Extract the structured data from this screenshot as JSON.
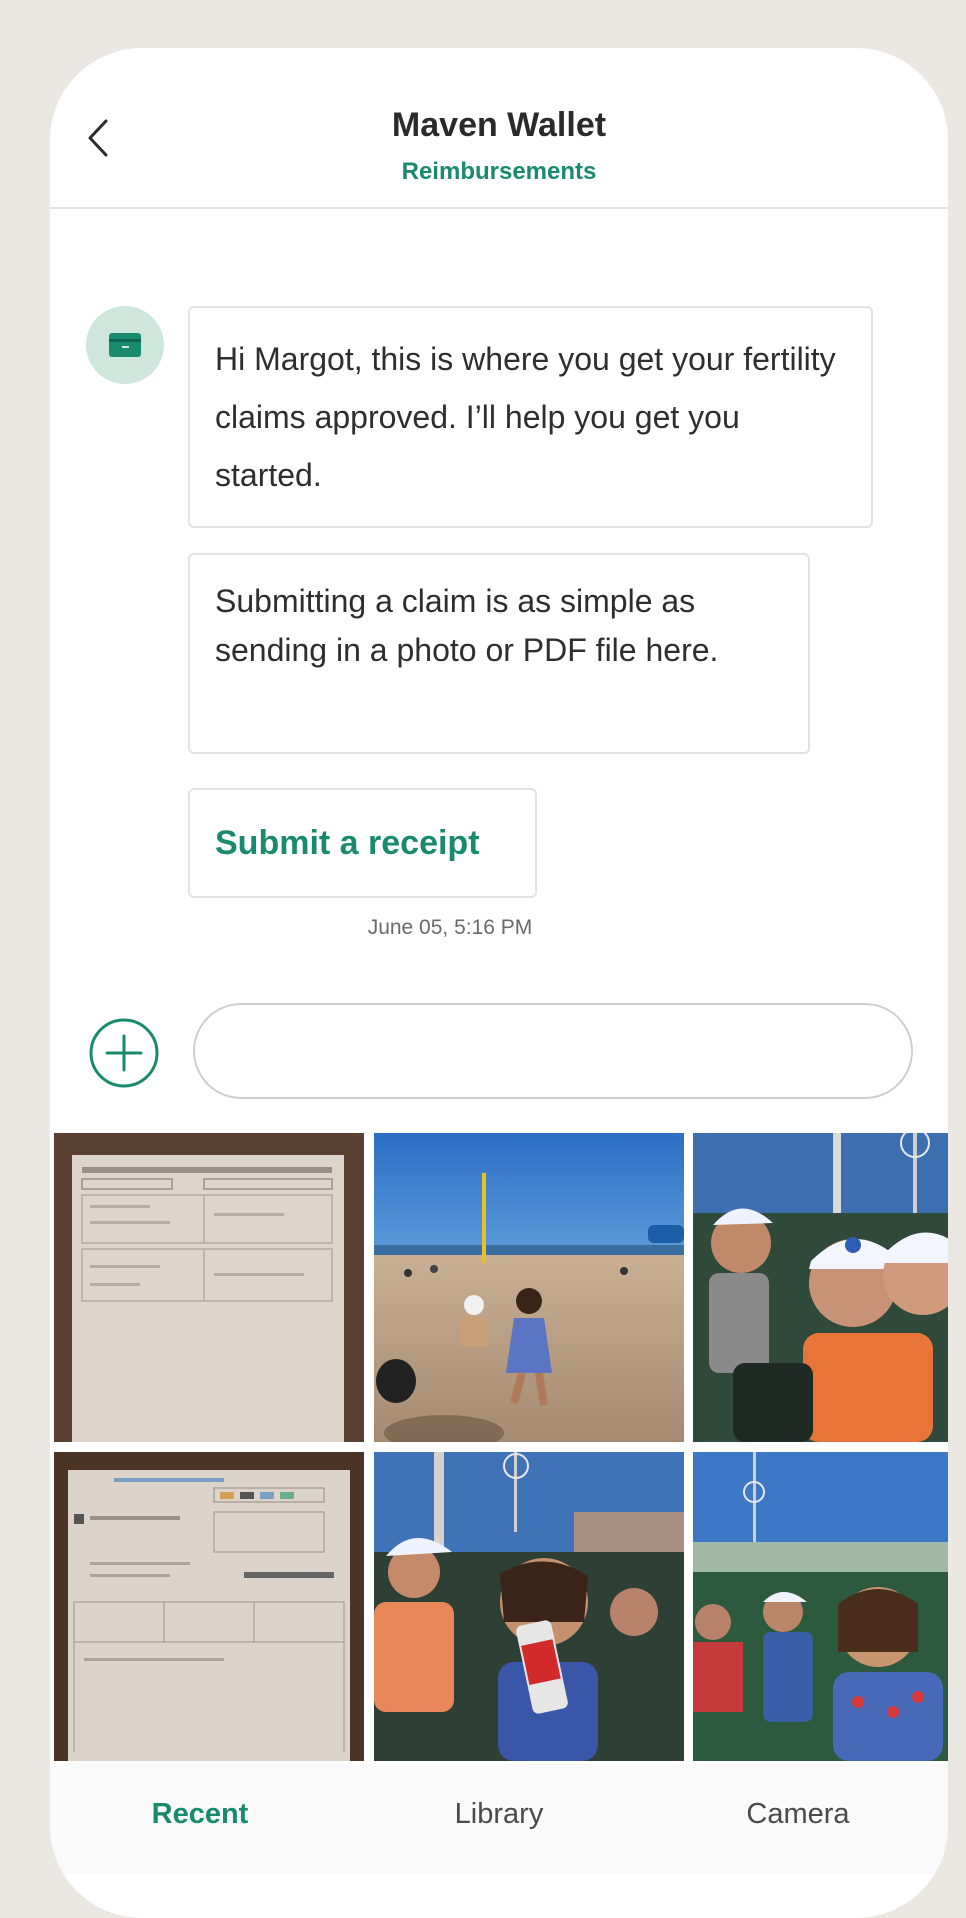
{
  "header": {
    "title": "Maven Wallet",
    "subtitle": "Reimbursements"
  },
  "chat": {
    "messages": [
      "Hi Margot, this is where you get your fertility claims approved. I’ll help you get you started.",
      "Submitting a claim is as simple as sending in a photo or PDF file here."
    ],
    "action_label": "Submit a receipt",
    "timestamp": "June 05, 5:16 PM"
  },
  "composer": {
    "placeholder": ""
  },
  "photos": [
    {
      "name": "receipt-document"
    },
    {
      "name": "beach-photo"
    },
    {
      "name": "ballpark-photo"
    },
    {
      "name": "receipt-document"
    },
    {
      "name": "ballpark-photo"
    },
    {
      "name": "ballpark-photo"
    }
  ],
  "tabs": {
    "recent": "Recent",
    "library": "Library",
    "camera": "Camera"
  },
  "colors": {
    "accent": "#1a8a6f",
    "avatar_bg": "#cfe6dd",
    "background": "#ebe8e3"
  }
}
